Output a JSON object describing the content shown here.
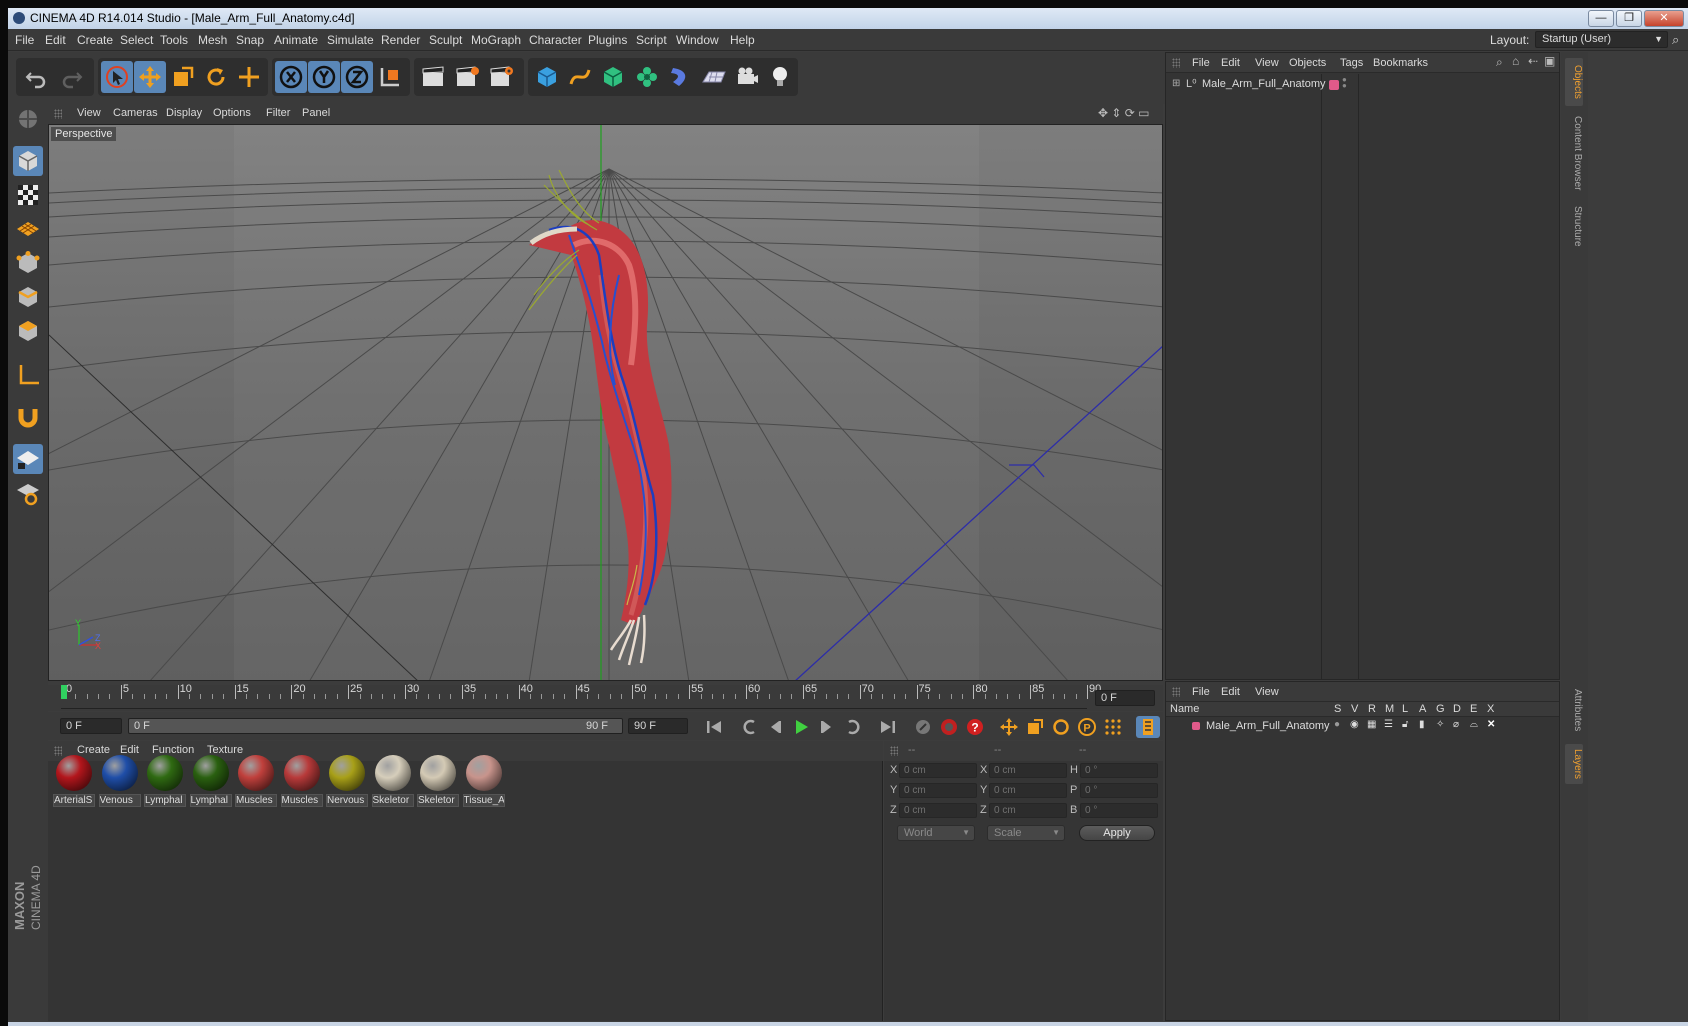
{
  "window": {
    "title": "CINEMA 4D R14.014 Studio - [Male_Arm_Full_Anatomy.c4d]",
    "minimize": "—",
    "restore": "❐",
    "close": "✕"
  },
  "menubar": {
    "items": [
      "File",
      "Edit",
      "Create",
      "Select",
      "Tools",
      "Mesh",
      "Snap",
      "Animate",
      "Simulate",
      "Render",
      "Sculpt",
      "MoGraph",
      "Character",
      "Plugins",
      "Script",
      "Window",
      "Help"
    ],
    "layout_label": "Layout:",
    "layout_value": "Startup (User)"
  },
  "viewport": {
    "menu": [
      "View",
      "Cameras",
      "Display",
      "Options",
      "Filter",
      "Panel"
    ],
    "label": "Perspective",
    "axis_y": "Y",
    "axis_z": "Z",
    "axis_x": "X"
  },
  "timeline": {
    "ticks": [
      "0",
      "5",
      "10",
      "15",
      "20",
      "25",
      "30",
      "35",
      "40",
      "45",
      "50",
      "55",
      "60",
      "65",
      "70",
      "75",
      "80",
      "85",
      "90"
    ],
    "current_frame": "0 F",
    "start_field": "0 F",
    "range_start": "0 F",
    "range_end": "90 F",
    "end_field": "90 F"
  },
  "materials": {
    "menu": [
      "Create",
      "Edit",
      "Function",
      "Texture"
    ],
    "items": [
      {
        "label": "ArterialS",
        "color": "#b3161c"
      },
      {
        "label": "Venous",
        "color": "#1f4ea8"
      },
      {
        "label": "Lymphal",
        "color": "#2f6a12"
      },
      {
        "label": "Lymphal",
        "color": "#2a6010"
      },
      {
        "label": "Muscles",
        "color": "#c0403c"
      },
      {
        "label": "Muscles",
        "color": "#b83a3a"
      },
      {
        "label": "Nervous",
        "color": "#a8a018"
      },
      {
        "label": "Skeletor",
        "color": "#d6cebb"
      },
      {
        "label": "Skeletor",
        "color": "#d4cab5"
      },
      {
        "label": "Tissue_A",
        "color": "#c8948c"
      }
    ]
  },
  "coords": {
    "header": [
      "--",
      "--",
      "--"
    ],
    "rows": [
      {
        "a": "X",
        "av": "0 cm",
        "b": "X",
        "bv": "0 cm",
        "c": "H",
        "cv": "0 °"
      },
      {
        "a": "Y",
        "av": "0 cm",
        "b": "Y",
        "bv": "0 cm",
        "c": "P",
        "cv": "0 °"
      },
      {
        "a": "Z",
        "av": "0 cm",
        "b": "Z",
        "bv": "0 cm",
        "c": "B",
        "cv": "0 °"
      }
    ],
    "world": "World",
    "scale": "Scale",
    "apply": "Apply"
  },
  "objects": {
    "menu": [
      "File",
      "Edit",
      "View",
      "Objects",
      "Tags",
      "Bookmarks"
    ],
    "item": "Male_Arm_Full_Anatomy",
    "item_color": "#e05a8a"
  },
  "layers": {
    "menu": [
      "File",
      "Edit",
      "View"
    ],
    "columns": [
      "Name",
      "S",
      "V",
      "R",
      "M",
      "L",
      "A",
      "G",
      "D",
      "E",
      "X"
    ],
    "item": "Male_Arm_Full_Anatomy",
    "item_color": "#e05a8a"
  },
  "sidetabs": [
    "Objects",
    "Content Browser",
    "Structure",
    "Attributes",
    "Layers"
  ],
  "brand": {
    "maxon": "MAXON",
    "cinema": "CINEMA 4D"
  }
}
